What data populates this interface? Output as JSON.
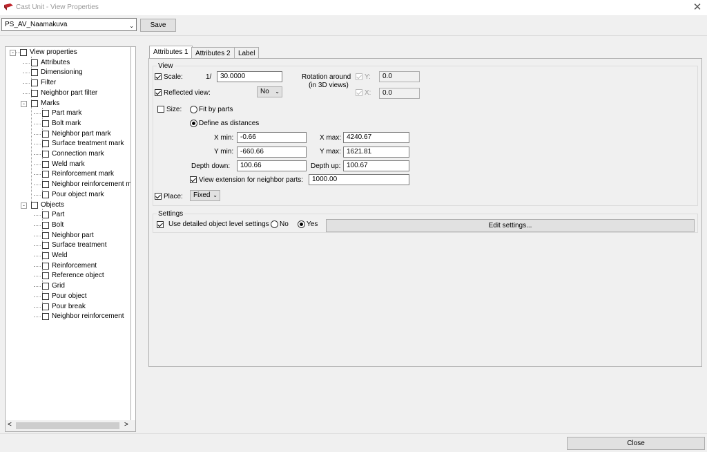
{
  "window": {
    "title": "Cast Unit - View Properties",
    "close_glyph": "✕"
  },
  "toolbar": {
    "preset_value": "PS_AV_Naamakuva",
    "save_label": "Save"
  },
  "tree": {
    "root_label": "View properties",
    "items": [
      "Attributes",
      "Dimensioning",
      "Filter",
      "Neighbor part filter"
    ],
    "marks_label": "Marks",
    "marks": [
      "Part mark",
      "Bolt mark",
      "Neighbor part mark",
      "Surface treatment mark",
      "Connection mark",
      "Weld mark",
      "Reinforcement mark",
      "Neighbor reinforcement ma",
      "Pour object mark"
    ],
    "objects_label": "Objects",
    "objects": [
      "Part",
      "Bolt",
      "Neighbor part",
      "Surface treatment",
      "Weld",
      "Reinforcement",
      "Reference object",
      "Grid",
      "Pour object",
      "Pour break",
      "Neighbor reinforcement"
    ],
    "scroll_left": "<",
    "scroll_right": ">"
  },
  "tabs": [
    "Attributes 1",
    "Attributes 2",
    "Label"
  ],
  "view_group": {
    "title": "View",
    "scale_label": "Scale:",
    "scale_prefix": "1/",
    "scale_value": "30.0000",
    "rotation_label_1": "Rotation around",
    "rotation_label_2": "(in 3D views)",
    "rot_y_label": "Y:",
    "rot_y_value": "0.0",
    "rot_x_label": "X:",
    "rot_x_value": "0.0",
    "reflected_label": "Reflected view:",
    "reflected_value": "No",
    "size_label": "Size:",
    "fit_by_parts_label": "Fit by parts",
    "define_distances_label": "Define as distances",
    "xmin_label": "X min:",
    "xmin_value": "-0.66",
    "xmax_label": "X max:",
    "xmax_value": "4240.67",
    "ymin_label": "Y min:",
    "ymin_value": "-660.66",
    "ymax_label": "Y max:",
    "ymax_value": "1621.81",
    "depth_down_label": "Depth down:",
    "depth_down_value": "100.66",
    "depth_up_label": "Depth up:",
    "depth_up_value": "100.67",
    "view_ext_label": "View extension for neighbor parts:",
    "view_ext_value": "1000.00",
    "place_label": "Place:",
    "place_value": "Fixed"
  },
  "settings_group": {
    "title": "Settings",
    "detailed_label": "Use detailed object level settings",
    "no_label": "No",
    "yes_label": "Yes",
    "edit_label": "Edit settings..."
  },
  "footer": {
    "close_label": "Close"
  },
  "colors": {
    "icon_red": "#c0262d"
  }
}
